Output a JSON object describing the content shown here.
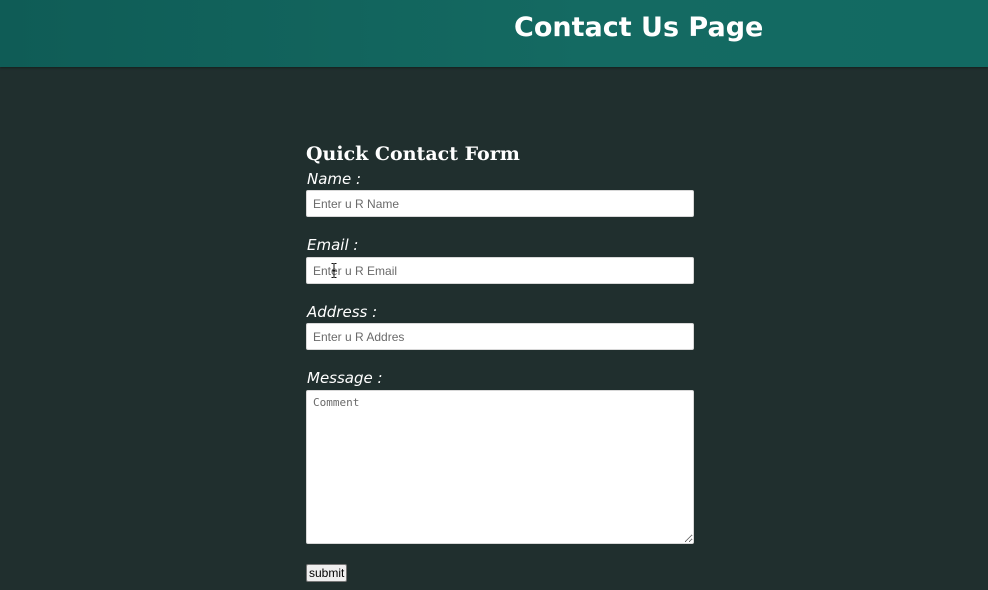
{
  "header": {
    "title": "Contact Us Page"
  },
  "form": {
    "title": "Quick Contact Form",
    "name": {
      "label": "Name :",
      "placeholder": "Enter u R Name",
      "value": ""
    },
    "email": {
      "label": "Email :",
      "placeholder": "Enter u R Email",
      "value": ""
    },
    "address": {
      "label": "Address :",
      "placeholder": "Enter u R Addres",
      "value": ""
    },
    "message": {
      "label": "Message :",
      "placeholder": "Comment",
      "value": ""
    },
    "submit_label": "submit"
  },
  "colors": {
    "header_bg": "#126a62",
    "page_bg": "#202f2e",
    "text": "#ffffff"
  },
  "icons": {
    "cursor": "text-cursor-icon"
  }
}
